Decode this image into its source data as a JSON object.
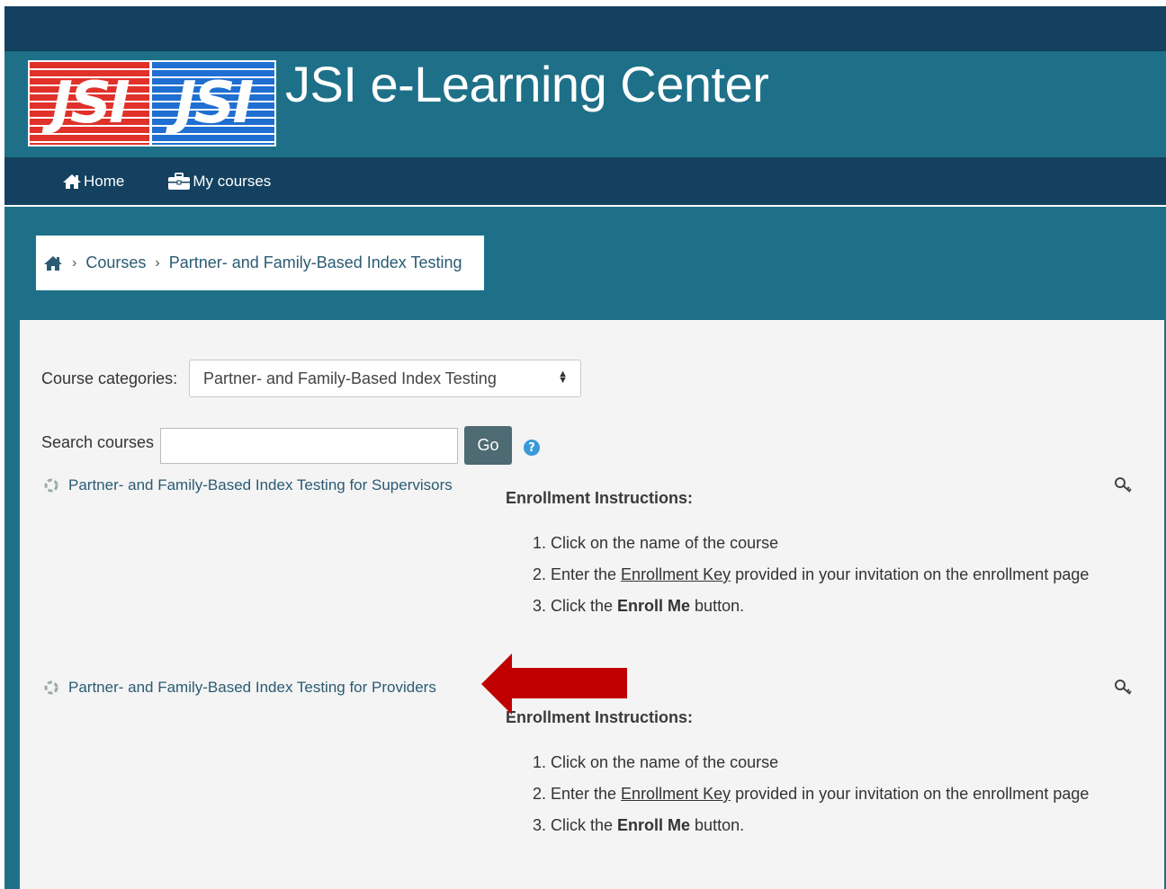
{
  "site": {
    "logo_text_left": "JSI",
    "logo_text_right": "JSI",
    "title": "JSI e-Learning Center"
  },
  "nav": {
    "home": "Home",
    "my_courses": "My courses"
  },
  "breadcrumb": {
    "courses": "Courses",
    "current": "Partner- and Family-Based Index Testing"
  },
  "filters": {
    "categories_label": "Course categories:",
    "categories_value": "Partner- and Family-Based Index Testing",
    "search_label": "Search courses",
    "search_value": "",
    "go_label": "Go"
  },
  "courses": [
    {
      "name": "Partner- and Family-Based Index Testing for Supervisors",
      "instructions_title": "Enrollment Instructions:",
      "steps": [
        {
          "num": "1.",
          "pre": "Click on the name of the course",
          "link": "",
          "post": "",
          "bold": ""
        },
        {
          "num": "2.",
          "pre": "Enter the ",
          "link": "Enrollment Key",
          "post": " provided in your invitation on the enrollment page",
          "bold": ""
        },
        {
          "num": "3.",
          "pre": "Click the ",
          "link": "",
          "post": " button.",
          "bold": "Enroll Me"
        }
      ]
    },
    {
      "name": "Partner- and Family-Based Index Testing for Providers",
      "instructions_title": "Enrollment Instructions:",
      "steps": [
        {
          "num": "1.",
          "pre": "Click on the name of the course",
          "link": "",
          "post": "",
          "bold": ""
        },
        {
          "num": "2.",
          "pre": "Enter the ",
          "link": "Enrollment Key",
          "post": " provided in your invitation on the enrollment page",
          "bold": ""
        },
        {
          "num": "3.",
          "pre": "Click the ",
          "link": "",
          "post": " button.",
          "bold": "Enroll Me"
        }
      ]
    }
  ],
  "colors": {
    "topbar": "#13415f",
    "header": "#1e7088",
    "arrow": "#c00000"
  }
}
